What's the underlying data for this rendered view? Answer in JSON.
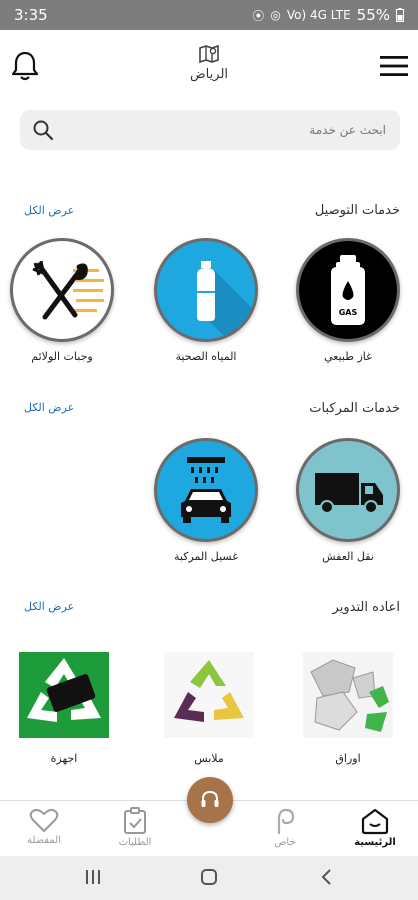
{
  "status": {
    "time": "3:35",
    "battery": "55%",
    "network": "Vo) 4G LTE"
  },
  "header": {
    "city": "الرياض",
    "bell_icon": "bell-icon",
    "menu_icon": "menu-icon",
    "map_icon": "map-icon"
  },
  "search": {
    "placeholder": "ابحث عن خدمة"
  },
  "sections": [
    {
      "title": "خدمات التوصيل",
      "see_all": "عرض الكل",
      "items": [
        {
          "label": "غاز طبيعي",
          "icon": "gas-cylinder-icon",
          "bg": "#000000"
        },
        {
          "label": "المياه الصحية",
          "icon": "water-bottle-icon",
          "bg": "#1fa7e0"
        },
        {
          "label": "وجبات الولائم",
          "icon": "fork-spoon-icon",
          "bg": "#ffffff"
        }
      ]
    },
    {
      "title": "خدمات المركبات",
      "see_all": "عرض الكل",
      "items": [
        {
          "label": "نقل العفش",
          "icon": "truck-icon",
          "bg": "#7fc3cc"
        },
        {
          "label": "غسيل المركبة",
          "icon": "car-wash-icon",
          "bg": "#1fa7e0"
        }
      ]
    },
    {
      "title": "اعاده التدوير",
      "see_all": "عرض الكل",
      "items": [
        {
          "label": "اوراق",
          "icon": "paper-recycle-icon"
        },
        {
          "label": "ملابس",
          "icon": "clothes-recycle-icon"
        },
        {
          "label": "اجهزة",
          "icon": "devices-recycle-icon"
        }
      ]
    }
  ],
  "bottom_nav": [
    {
      "label": "الرئيسية",
      "icon": "home-icon",
      "active": true
    },
    {
      "label": "خاص",
      "icon": "private-icon",
      "active": false
    },
    {
      "label": "الطلبات",
      "icon": "orders-clipboard-icon",
      "active": false
    },
    {
      "label": "المفضلة",
      "icon": "heart-icon",
      "active": false
    }
  ],
  "fab": {
    "icon": "headset-icon",
    "color": "#a77449"
  },
  "colors": {
    "link": "#1e6fbf",
    "accent": "#a77449"
  }
}
